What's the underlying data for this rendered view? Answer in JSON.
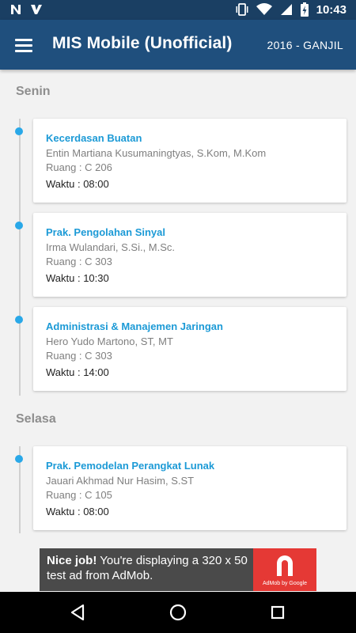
{
  "status_bar": {
    "time": "10:43",
    "icons": [
      "n-notification-icon",
      "delivery-notification-icon",
      "vibrate-icon",
      "wifi-icon",
      "signal-icon",
      "battery-charging-icon"
    ]
  },
  "app_bar": {
    "title": "MIS Mobile (Unofficial)",
    "semester": "2016 - GANJIL",
    "menu_icon": "hamburger-menu-icon"
  },
  "colors": {
    "status_bar": "#1a3f63",
    "app_bar": "#1f4f7d",
    "accent": "#1c9ad6",
    "timeline_dot": "#29a8e8",
    "background": "#f2f2f2",
    "ad_background": "#4a4a4a",
    "ad_logo": "#e53935"
  },
  "schedule": [
    {
      "day": "Senin",
      "classes": [
        {
          "subject": "Kecerdasan Buatan",
          "lecturer": "Entin Martiana Kusumaningtyas, S.Kom, M.Kom",
          "room": "Ruang : C 206",
          "time": "Waktu : 08:00"
        },
        {
          "subject": "Prak. Pengolahan Sinyal",
          "lecturer": "Irma Wulandari, S.Si., M.Sc.",
          "room": "Ruang : C 303",
          "time": "Waktu : 10:30"
        },
        {
          "subject": "Administrasi & Manajemen Jaringan",
          "lecturer": "Hero Yudo Martono, ST, MT",
          "room": "Ruang : C 303",
          "time": "Waktu : 14:00"
        }
      ]
    },
    {
      "day": "Selasa",
      "classes": [
        {
          "subject": "Prak. Pemodelan Perangkat Lunak",
          "lecturer": "Jauari Akhmad Nur Hasim, S.ST",
          "room": "Ruang : C 105",
          "time": "Waktu : 08:00"
        }
      ]
    }
  ],
  "ad": {
    "headline": "Nice job!",
    "text": "You're displaying a 320 x 50 test ad from AdMob.",
    "logo_caption": "AdMob by Google"
  },
  "nav_bar": {
    "buttons": [
      "back-icon",
      "home-icon",
      "recents-icon"
    ]
  }
}
